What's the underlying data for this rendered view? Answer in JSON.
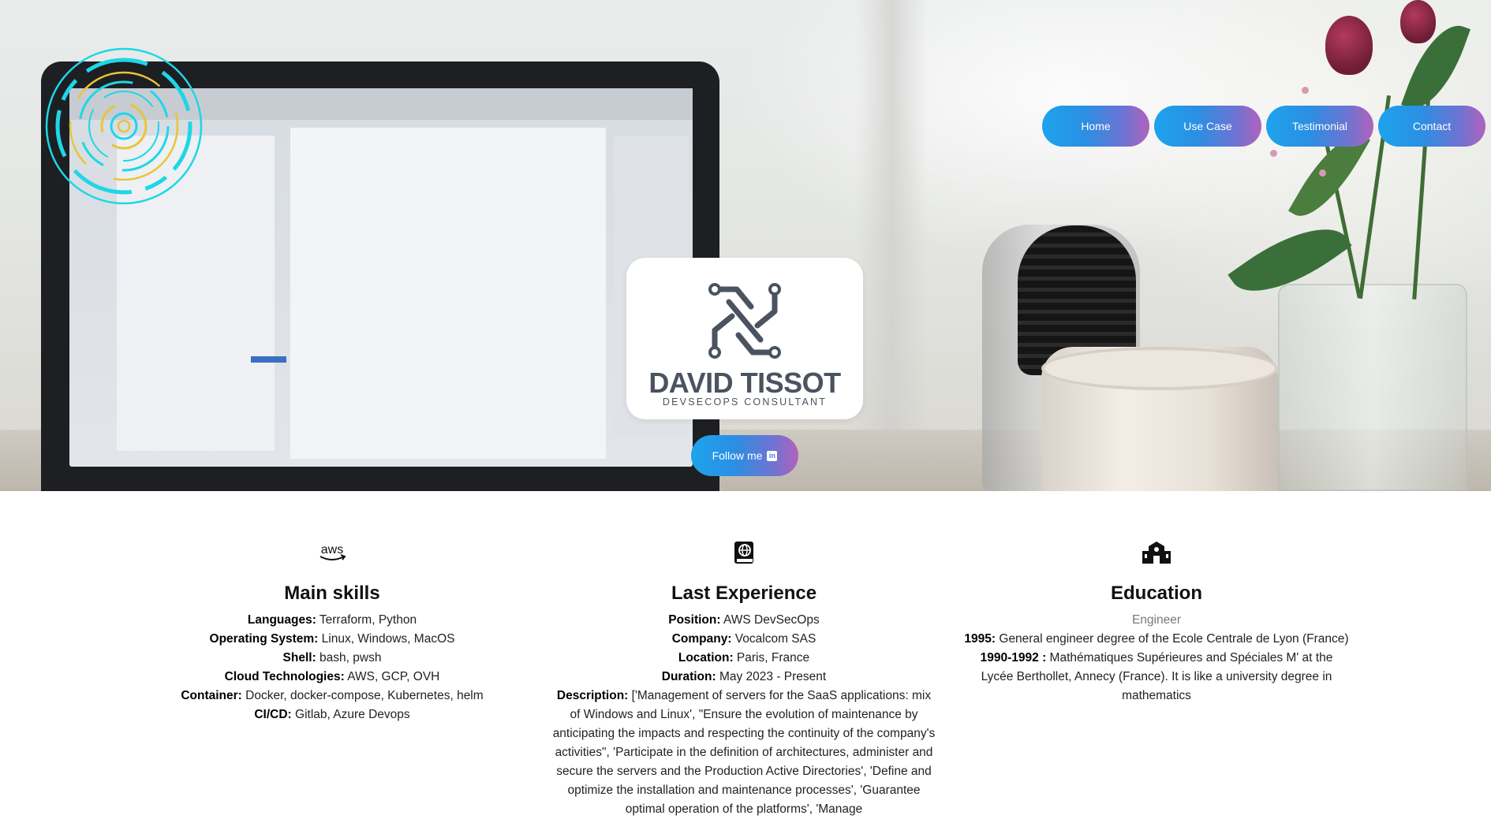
{
  "nav": {
    "items": [
      {
        "label": "Home"
      },
      {
        "label": "Use Case"
      },
      {
        "label": "Testimonial"
      },
      {
        "label": "Contact"
      }
    ]
  },
  "brand": {
    "name": "DAVID TISSOT",
    "subtitle": "DEVSECOPS CONSULTANT",
    "logo_icon": "circuit-monogram-icon",
    "ring_icon": "circular-tech-ring-icon"
  },
  "follow": {
    "label": "Follow me",
    "icon": "linkedin-icon"
  },
  "skills": {
    "icon": "aws-icon",
    "title": "Main skills",
    "rows": [
      {
        "key": "Languages:",
        "value": " Terraform, Python"
      },
      {
        "key": "Operating System:",
        "value": " Linux, Windows, MacOS"
      },
      {
        "key": "Shell:",
        "value": " bash, pwsh"
      },
      {
        "key": "Cloud Technologies:",
        "value": " AWS, GCP, OVH"
      },
      {
        "key": "Container:",
        "value": " Docker, docker-compose, Kubernetes, helm"
      },
      {
        "key": "CI/CD:",
        "value": " Gitlab, Azure Devops"
      }
    ]
  },
  "experience": {
    "icon": "book-globe-icon",
    "title": "Last Experience",
    "position_key": "Position:",
    "position": " AWS DevSecOps",
    "company_key": "Company:",
    "company": " Vocalcom SAS",
    "location_key": "Location:",
    "location": " Paris, France",
    "duration_key": "Duration:",
    "duration": " May 2023 - Present",
    "description_key": "Description:",
    "description": " ['Management of servers for the SaaS applications: mix of Windows and Linux', \"Ensure the evolution of maintenance by anticipating the impacts and respecting the continuity of the company's activities\", 'Participate in the definition of architectures, administer and secure the servers and the Production Active Directories', 'Define and optimize the installation and maintenance processes', 'Guarantee optimal operation of the platforms', 'Manage"
  },
  "education": {
    "icon": "school-icon",
    "title": "Education",
    "subtitle": "Engineer",
    "row1_key": "1995:",
    "row1": " General engineer degree of the Ecole Centrale de Lyon (France)",
    "row2_key": "1990-1992 :",
    "row2": " Mathématiques Supérieures and Spéciales M' at the Lycée Berthollet, Annecy (France). It is like a university degree in mathematics"
  },
  "colors": {
    "button_gradient_start": "#1ea3ec",
    "button_gradient_end": "#b062bc",
    "ring_cyan": "#1fd6e6",
    "ring_yellow": "#e6c53a",
    "brand_text": "#4b5260"
  }
}
